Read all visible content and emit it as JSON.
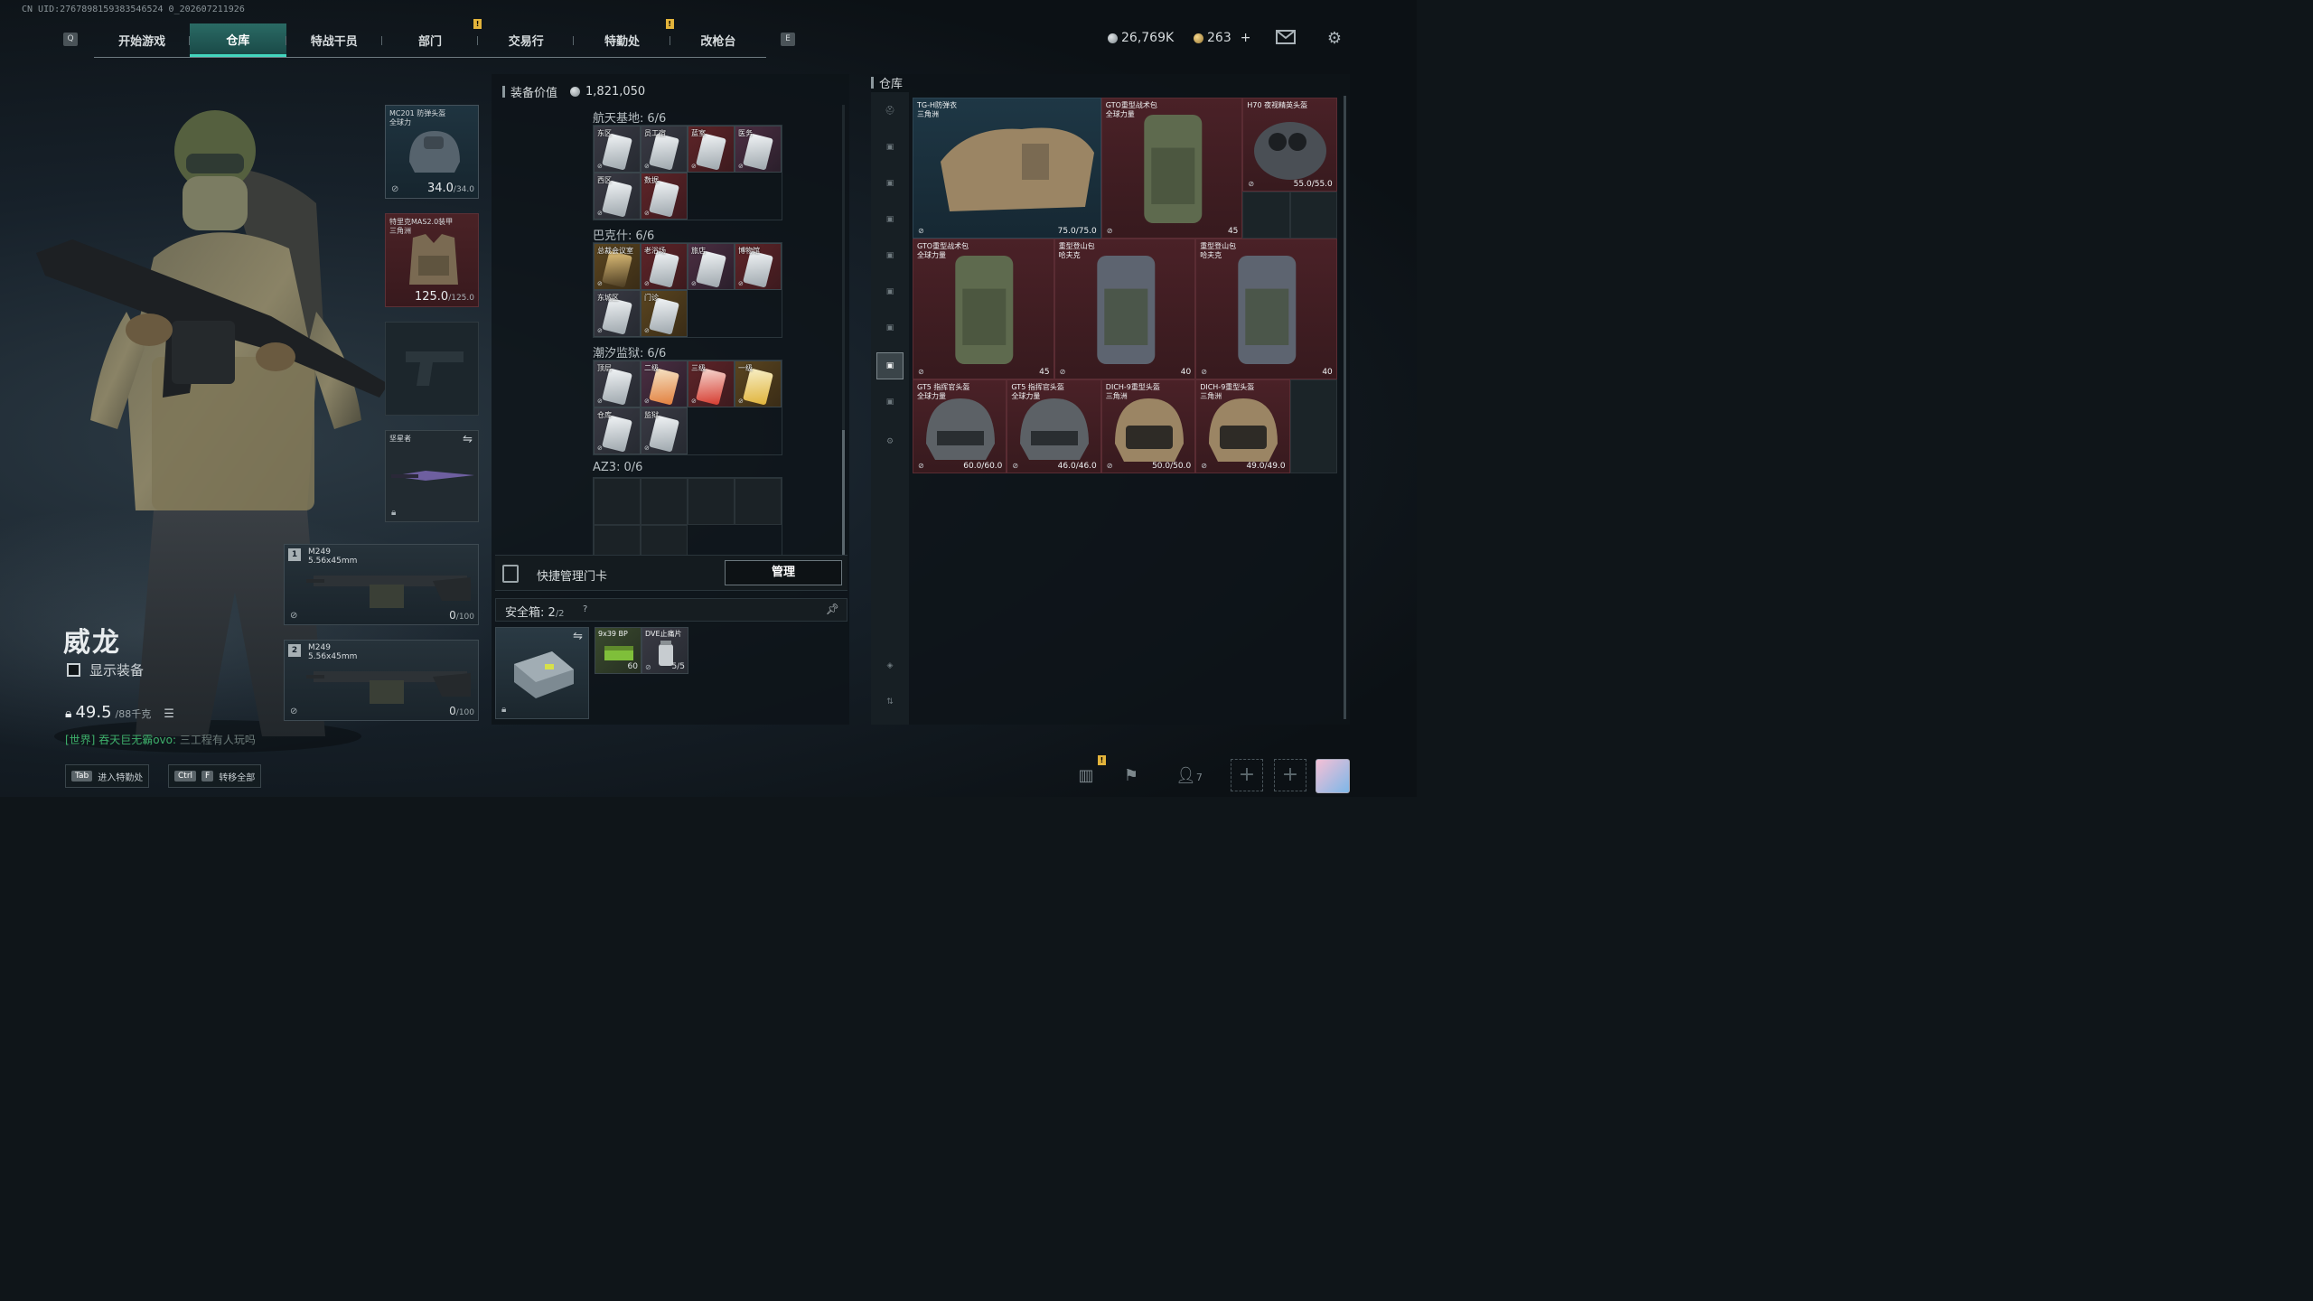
{
  "uid": "CN UID:2767898159383546524 0_202607211926",
  "nav": {
    "key_left": "Q",
    "key_right": "E",
    "tabs": [
      {
        "label": "开始游戏",
        "active": false,
        "alert": false
      },
      {
        "label": "仓库",
        "active": true,
        "alert": false
      },
      {
        "label": "特战干员",
        "active": false,
        "alert": false
      },
      {
        "label": "部门",
        "active": false,
        "alert": true
      },
      {
        "label": "交易行",
        "active": false,
        "alert": false
      },
      {
        "label": "特勤处",
        "active": false,
        "alert": true
      },
      {
        "label": "改枪台",
        "active": false,
        "alert": false
      }
    ],
    "alert_mark": "!"
  },
  "currency": {
    "silver": "26,769K",
    "gold": "263",
    "gold_plus": "+"
  },
  "icons": {
    "mail": "mail-icon",
    "settings": "gear-icon"
  },
  "character": {
    "name": "威龙",
    "show_equipment": "显示装备",
    "weight_value": "49.5",
    "weight_max": "/88千克"
  },
  "chat": {
    "channel": "[世界]",
    "user": "吞天巨无霸ovo:",
    "message": "三工程有人玩吗"
  },
  "equip": {
    "helmet": {
      "name": "MC201 防弹头盔",
      "sub": "全球力",
      "dur": "34.0",
      "max": "/34.0"
    },
    "armor": {
      "name": "特里克MAS2.0装甲",
      "sub": "三角洲",
      "dur": "125.0",
      "max": "/125.0"
    },
    "melee": {
      "name": "坚星者"
    },
    "primary": {
      "num": "1",
      "name": "M249",
      "caliber": "5.56x45mm",
      "ammo": "0",
      "ammo_max": "/100"
    },
    "secondary": {
      "num": "2",
      "name": "M249",
      "caliber": "5.56x45mm",
      "ammo": "0",
      "ammo_max": "/100"
    }
  },
  "center": {
    "title": "装备价值",
    "value": "1,821,050",
    "groups": [
      {
        "name": "航天基地:",
        "count": "6/6",
        "cards": [
          {
            "label": "东区",
            "tone": "",
            "kc": ""
          },
          {
            "label": "员工宿",
            "tone": "",
            "kc": ""
          },
          {
            "label": "蓝室",
            "tone": "red",
            "kc": ""
          },
          {
            "label": "医务",
            "tone": "purple",
            "kc": ""
          },
          {
            "label": "西区",
            "tone": "",
            "kc": ""
          },
          {
            "label": "数据",
            "tone": "red",
            "kc": ""
          }
        ]
      },
      {
        "name": "巴克什:",
        "count": "6/6",
        "cards": [
          {
            "label": "总裁会议室",
            "tone": "gold",
            "kc": "k"
          },
          {
            "label": "老浴场",
            "tone": "red",
            "kc": ""
          },
          {
            "label": "旅店",
            "tone": "purple",
            "kc": ""
          },
          {
            "label": "博物馆",
            "tone": "red",
            "kc": ""
          },
          {
            "label": "东城区",
            "tone": "",
            "kc": ""
          },
          {
            "label": "门诊",
            "tone": "gold",
            "kc": ""
          }
        ]
      },
      {
        "name": "潮汐监狱:",
        "count": "6/6",
        "cards": [
          {
            "label": "顶层",
            "tone": "",
            "kc": ""
          },
          {
            "label": "二级",
            "tone": "purple",
            "kc": "o"
          },
          {
            "label": "三级",
            "tone": "red",
            "kc": "r"
          },
          {
            "label": "一级",
            "tone": "gold",
            "kc": "y"
          },
          {
            "label": "仓库",
            "tone": "",
            "kc": ""
          },
          {
            "label": "监狱",
            "tone": "",
            "kc": ""
          }
        ]
      },
      {
        "name": "AZ3:",
        "count": "0/6",
        "cards": []
      }
    ],
    "quick_manage": "快捷管理门卡",
    "manage_btn": "管理",
    "safe_label": "安全箱:",
    "safe_count": "2",
    "safe_max": "/2",
    "safe_help": "?",
    "safe_items": [
      {
        "label": "9x39 BP",
        "count": "60"
      },
      {
        "label": "DVE止痛片",
        "count": "5/5"
      }
    ]
  },
  "warehouse": {
    "title": "仓库",
    "items": [
      {
        "name": "TG-H防弹衣",
        "sub": "三角洲",
        "dur": "75.0/75.0",
        "cap": "",
        "tone": "blue"
      },
      {
        "name": "GTO重型战术包",
        "sub": "全球力量",
        "dur": "",
        "cap": "45",
        "tone": "red"
      },
      {
        "name": "H70 夜视精英头盔",
        "sub": "",
        "dur": "55.0/55.0",
        "cap": "",
        "tone": "red"
      },
      {
        "name": "GTO重型战术包",
        "sub": "全球力量",
        "dur": "",
        "cap": "45",
        "tone": "red"
      },
      {
        "name": "重型登山包",
        "sub": "哈夫克",
        "dur": "",
        "cap": "40",
        "tone": "red"
      },
      {
        "name": "重型登山包",
        "sub": "哈夫克",
        "dur": "",
        "cap": "40",
        "tone": "red"
      },
      {
        "name": "GT5 指挥官头盔",
        "sub": "全球力量",
        "dur": "60.0/60.0",
        "cap": "",
        "tone": "red"
      },
      {
        "name": "GT5 指挥官头盔",
        "sub": "全球力量",
        "dur": "46.0/46.0",
        "cap": "",
        "tone": "red"
      },
      {
        "name": "DICH-9重型头盔",
        "sub": "三角洲",
        "dur": "50.0/50.0",
        "cap": "",
        "tone": "red"
      },
      {
        "name": "DICH-9重型头盔",
        "sub": "三角洲",
        "dur": "49.0/49.0",
        "cap": "",
        "tone": "red"
      }
    ]
  },
  "bottom": {
    "tab_key": "Tab",
    "tab_label": "进入特勤处",
    "ctrl_key": "Ctrl",
    "f_key": "F",
    "transfer_label": "转移全部",
    "friends": "7"
  }
}
